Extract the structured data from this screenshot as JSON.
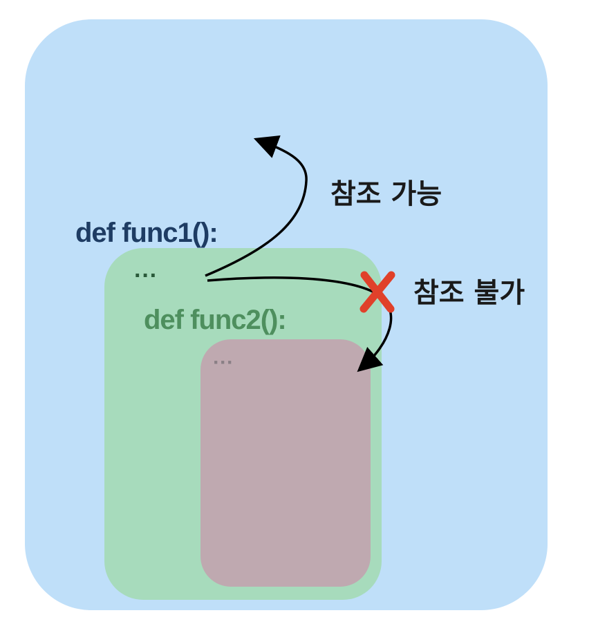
{
  "diagram": {
    "func1": {
      "label": "def func1():",
      "ellipsis": "···"
    },
    "func2": {
      "label": "def func2():",
      "ellipsis": "···"
    },
    "arrows": {
      "possible_label": "참조 가능",
      "impossible_label": "참조 불가"
    },
    "colors": {
      "outer_scope": "#bfdff9",
      "func1_scope": "#a7dbbc",
      "func2_scope": "#bfa9b0",
      "func1_text": "#1e3c63",
      "func2_text": "#4e8f5e",
      "cross_mark": "#e0402a"
    },
    "icons": {
      "blocked": "cross-icon"
    }
  }
}
